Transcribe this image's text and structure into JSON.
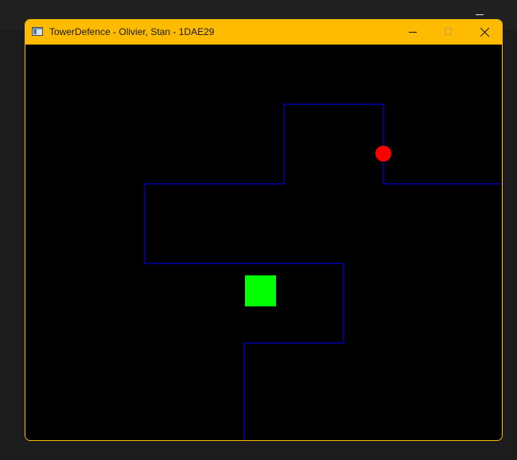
{
  "window": {
    "title": "TowerDefence - Olivier, Stan - 1DAE29",
    "titlebar_color": "#ffbb00",
    "icon": "app-window-icon",
    "controls": [
      "minimize-icon",
      "maximize-icon",
      "close-icon"
    ]
  },
  "game": {
    "background": "#000000",
    "path_color": "#0000ff",
    "enemy": {
      "shape": "circle",
      "color": "#ff0000"
    },
    "tower": {
      "shape": "square",
      "color": "#00ff00"
    }
  },
  "desktop": {
    "background": "#1c1c1c",
    "icons": [
      "minimize-icon",
      "close-icon"
    ]
  }
}
